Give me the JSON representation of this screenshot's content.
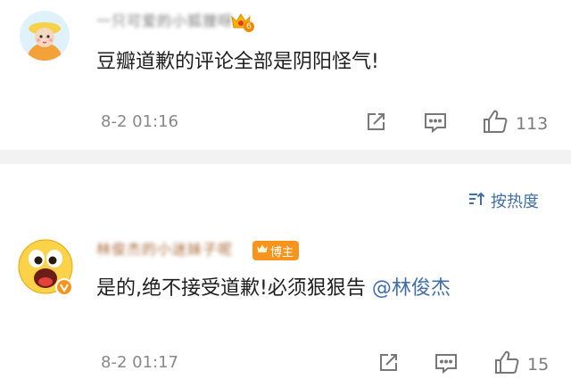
{
  "comments": [
    {
      "username": "一只可爱的小狐狸呀",
      "text": "豆瓣道歉的评论全部是阴阳怪气!",
      "time": "8-2 01:16",
      "likes": "113",
      "vip_level": "6"
    },
    {
      "username": "林俊杰的小迷妹子呢",
      "badge": "博主",
      "text": "是的,绝不接受道歉!必须狠狠告",
      "mention": "@林俊杰",
      "time": "8-2 01:17",
      "likes": "15"
    }
  ],
  "sort": {
    "label": "按热度"
  },
  "icons": {
    "share": "share-icon",
    "comment": "comment-icon",
    "like": "thumbs-up-icon",
    "sort": "sort-icon",
    "crown": "crown-icon",
    "verified": "verified-v-icon"
  },
  "colors": {
    "link": "#3f6ea8",
    "meta": "#888888",
    "divider": "#f2f2f2",
    "badge": "#f7941d"
  }
}
